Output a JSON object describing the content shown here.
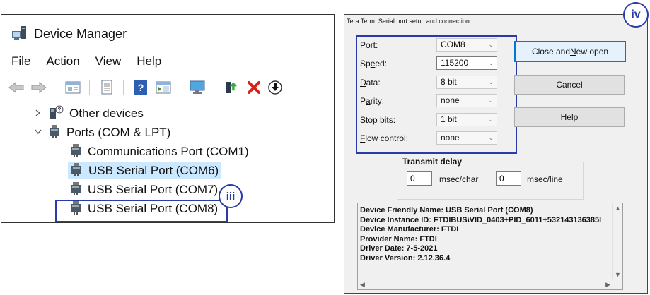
{
  "device_manager": {
    "title": "Device Manager",
    "menu": {
      "file": "ile",
      "file_key": "F",
      "action": "ction",
      "action_key": "A",
      "view": "iew",
      "view_key": "V",
      "help": "elp",
      "help_key": "H"
    },
    "tree": {
      "other_devices": "Other devices",
      "ports": "Ports (COM & LPT)",
      "items": [
        "Communications Port (COM1)",
        "USB Serial Port (COM6)",
        "USB Serial Port (COM7)",
        "USB Serial Port (COM8)"
      ]
    },
    "badge": "iii"
  },
  "tera_term": {
    "title": "Tera Term: Serial port setup and connection",
    "badge": "iv",
    "fields": {
      "port_key": "P",
      "port_rest": "ort:",
      "port_value": "COM8",
      "speed_key": "e",
      "speed_pre": "Sp",
      "speed_rest": "ed:",
      "speed_value": "115200",
      "data_key": "D",
      "data_rest": "ata:",
      "data_value": "8 bit",
      "parity_pre": "P",
      "parity_key": "a",
      "parity_rest": "rity:",
      "parity_value": "none",
      "stop_key": "S",
      "stop_rest": "top bits:",
      "stop_value": "1 bit",
      "flow_key": "F",
      "flow_rest": "low control:",
      "flow_value": "none"
    },
    "buttons": {
      "close_pre": "Close and ",
      "close_key": "N",
      "close_rest": "ew open",
      "cancel": "Cancel",
      "help_key": "H",
      "help_rest": "elp"
    },
    "transmit_delay": {
      "label": "Transmit delay",
      "char_value": "0",
      "char_unit_pre": "msec/",
      "char_unit_key": "c",
      "char_unit_rest": "har",
      "line_value": "0",
      "line_unit_pre": "msec/",
      "line_unit_key": "l",
      "line_unit_rest": "ine"
    },
    "info_lines": [
      "Device Friendly Name: USB Serial Port (COM8)",
      "Device Instance ID: FTDIBUS\\VID_0403+PID_6011+532143136385l",
      "Device Manufacturer: FTDI",
      "Provider Name: FTDI",
      "Driver Date: 7-5-2021",
      "Driver Version: 2.12.36.4"
    ]
  },
  "colors": {
    "highlight_border": "#2a3ba8",
    "selection": "#cce8ff",
    "primary_button_border": "#0078d7"
  }
}
